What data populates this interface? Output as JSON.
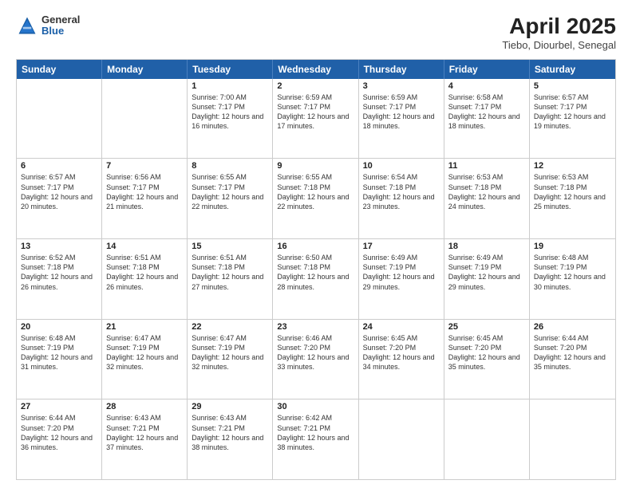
{
  "header": {
    "logo": {
      "general": "General",
      "blue": "Blue"
    },
    "title": "April 2025",
    "subtitle": "Tiebo, Diourbel, Senegal"
  },
  "calendar": {
    "days_of_week": [
      "Sunday",
      "Monday",
      "Tuesday",
      "Wednesday",
      "Thursday",
      "Friday",
      "Saturday"
    ],
    "rows": [
      [
        {
          "day": "",
          "empty": true
        },
        {
          "day": "",
          "empty": true
        },
        {
          "day": "1",
          "sunrise": "7:00 AM",
          "sunset": "7:17 PM",
          "daylight": "12 hours and 16 minutes."
        },
        {
          "day": "2",
          "sunrise": "6:59 AM",
          "sunset": "7:17 PM",
          "daylight": "12 hours and 17 minutes."
        },
        {
          "day": "3",
          "sunrise": "6:59 AM",
          "sunset": "7:17 PM",
          "daylight": "12 hours and 18 minutes."
        },
        {
          "day": "4",
          "sunrise": "6:58 AM",
          "sunset": "7:17 PM",
          "daylight": "12 hours and 18 minutes."
        },
        {
          "day": "5",
          "sunrise": "6:57 AM",
          "sunset": "7:17 PM",
          "daylight": "12 hours and 19 minutes."
        }
      ],
      [
        {
          "day": "6",
          "sunrise": "6:57 AM",
          "sunset": "7:17 PM",
          "daylight": "12 hours and 20 minutes."
        },
        {
          "day": "7",
          "sunrise": "6:56 AM",
          "sunset": "7:17 PM",
          "daylight": "12 hours and 21 minutes."
        },
        {
          "day": "8",
          "sunrise": "6:55 AM",
          "sunset": "7:17 PM",
          "daylight": "12 hours and 22 minutes."
        },
        {
          "day": "9",
          "sunrise": "6:55 AM",
          "sunset": "7:18 PM",
          "daylight": "12 hours and 22 minutes."
        },
        {
          "day": "10",
          "sunrise": "6:54 AM",
          "sunset": "7:18 PM",
          "daylight": "12 hours and 23 minutes."
        },
        {
          "day": "11",
          "sunrise": "6:53 AM",
          "sunset": "7:18 PM",
          "daylight": "12 hours and 24 minutes."
        },
        {
          "day": "12",
          "sunrise": "6:53 AM",
          "sunset": "7:18 PM",
          "daylight": "12 hours and 25 minutes."
        }
      ],
      [
        {
          "day": "13",
          "sunrise": "6:52 AM",
          "sunset": "7:18 PM",
          "daylight": "12 hours and 26 minutes."
        },
        {
          "day": "14",
          "sunrise": "6:51 AM",
          "sunset": "7:18 PM",
          "daylight": "12 hours and 26 minutes."
        },
        {
          "day": "15",
          "sunrise": "6:51 AM",
          "sunset": "7:18 PM",
          "daylight": "12 hours and 27 minutes."
        },
        {
          "day": "16",
          "sunrise": "6:50 AM",
          "sunset": "7:18 PM",
          "daylight": "12 hours and 28 minutes."
        },
        {
          "day": "17",
          "sunrise": "6:49 AM",
          "sunset": "7:19 PM",
          "daylight": "12 hours and 29 minutes."
        },
        {
          "day": "18",
          "sunrise": "6:49 AM",
          "sunset": "7:19 PM",
          "daylight": "12 hours and 29 minutes."
        },
        {
          "day": "19",
          "sunrise": "6:48 AM",
          "sunset": "7:19 PM",
          "daylight": "12 hours and 30 minutes."
        }
      ],
      [
        {
          "day": "20",
          "sunrise": "6:48 AM",
          "sunset": "7:19 PM",
          "daylight": "12 hours and 31 minutes."
        },
        {
          "day": "21",
          "sunrise": "6:47 AM",
          "sunset": "7:19 PM",
          "daylight": "12 hours and 32 minutes."
        },
        {
          "day": "22",
          "sunrise": "6:47 AM",
          "sunset": "7:19 PM",
          "daylight": "12 hours and 32 minutes."
        },
        {
          "day": "23",
          "sunrise": "6:46 AM",
          "sunset": "7:20 PM",
          "daylight": "12 hours and 33 minutes."
        },
        {
          "day": "24",
          "sunrise": "6:45 AM",
          "sunset": "7:20 PM",
          "daylight": "12 hours and 34 minutes."
        },
        {
          "day": "25",
          "sunrise": "6:45 AM",
          "sunset": "7:20 PM",
          "daylight": "12 hours and 35 minutes."
        },
        {
          "day": "26",
          "sunrise": "6:44 AM",
          "sunset": "7:20 PM",
          "daylight": "12 hours and 35 minutes."
        }
      ],
      [
        {
          "day": "27",
          "sunrise": "6:44 AM",
          "sunset": "7:20 PM",
          "daylight": "12 hours and 36 minutes."
        },
        {
          "day": "28",
          "sunrise": "6:43 AM",
          "sunset": "7:21 PM",
          "daylight": "12 hours and 37 minutes."
        },
        {
          "day": "29",
          "sunrise": "6:43 AM",
          "sunset": "7:21 PM",
          "daylight": "12 hours and 38 minutes."
        },
        {
          "day": "30",
          "sunrise": "6:42 AM",
          "sunset": "7:21 PM",
          "daylight": "12 hours and 38 minutes."
        },
        {
          "day": "",
          "empty": true
        },
        {
          "day": "",
          "empty": true
        },
        {
          "day": "",
          "empty": true
        }
      ]
    ]
  }
}
